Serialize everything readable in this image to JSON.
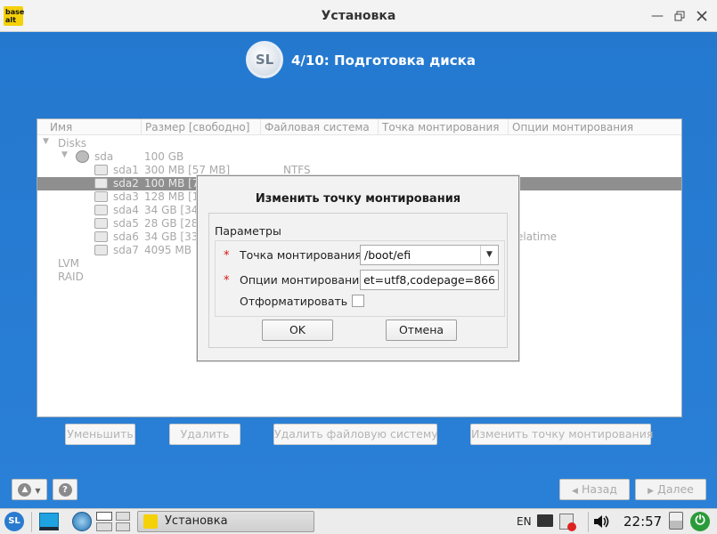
{
  "window": {
    "title": "Установка",
    "app_badge": "base alt"
  },
  "header": {
    "logo_text": "SL",
    "step_title": "4/10: Подготовка диска"
  },
  "partition_table": {
    "columns": [
      "Имя",
      "Размер [свободно]",
      "Файловая система",
      "Точка монтирования",
      "Опции монтирования"
    ],
    "rows": [
      {
        "name": "Disks",
        "size": "",
        "fs": "",
        "mount": "",
        "opts": "",
        "level": 0
      },
      {
        "name": "sda",
        "size": "100 GB",
        "fs": "",
        "mount": "",
        "opts": "",
        "level": 1
      },
      {
        "name": "sda1",
        "size": "300 MB [57 MB]",
        "fs": "NTFS",
        "mount": "",
        "opts": "",
        "level": 2
      },
      {
        "name": "sda2",
        "size": "100 MB [7",
        "fs": "",
        "mount": "",
        "opts": "",
        "level": 2,
        "selected": true
      },
      {
        "name": "sda3",
        "size": "128 MB [1",
        "fs": "",
        "mount": "",
        "opts": "",
        "level": 2
      },
      {
        "name": "sda4",
        "size": "34 GB [34",
        "fs": "",
        "mount": "",
        "opts": "",
        "level": 2
      },
      {
        "name": "sda5",
        "size": "28 GB [28",
        "fs": "",
        "mount": "",
        "opts": "",
        "level": 2
      },
      {
        "name": "sda6",
        "size": "34 GB [33",
        "fs": "",
        "mount": "",
        "opts": "elatime",
        "level": 2
      },
      {
        "name": "sda7",
        "size": "4095 MB",
        "fs": "",
        "mount": "",
        "opts": "",
        "level": 2
      },
      {
        "name": "LVM",
        "size": "",
        "fs": "",
        "mount": "",
        "opts": "",
        "level": 0
      },
      {
        "name": "RAID",
        "size": "",
        "fs": "",
        "mount": "",
        "opts": "",
        "level": 0
      }
    ]
  },
  "actions": {
    "shrink": "Уменьшить",
    "delete": "Удалить",
    "delete_fs": "Удалить файловую систему",
    "change_mount": "Изменить точку монтирования"
  },
  "dialog": {
    "title": "Изменить точку монтирования",
    "group": "Параметры",
    "required_mark": "*",
    "mount_point_label": "Точка монтирования",
    "mount_point_value": "/boot/efi",
    "mount_opts_label": "Опции монтирования",
    "mount_opts_value": "et=utf8,codepage=866",
    "format_label": "Отформатировать",
    "format_checked": false,
    "ok": "OK",
    "cancel": "Отмена"
  },
  "navigation": {
    "back": "Назад",
    "next": "Далее",
    "back_arrow": "◀",
    "next_arrow": "▶"
  },
  "taskbar": {
    "start_logo": "SL",
    "window_label": "Установка",
    "language": "EN",
    "clock": "22:57"
  }
}
